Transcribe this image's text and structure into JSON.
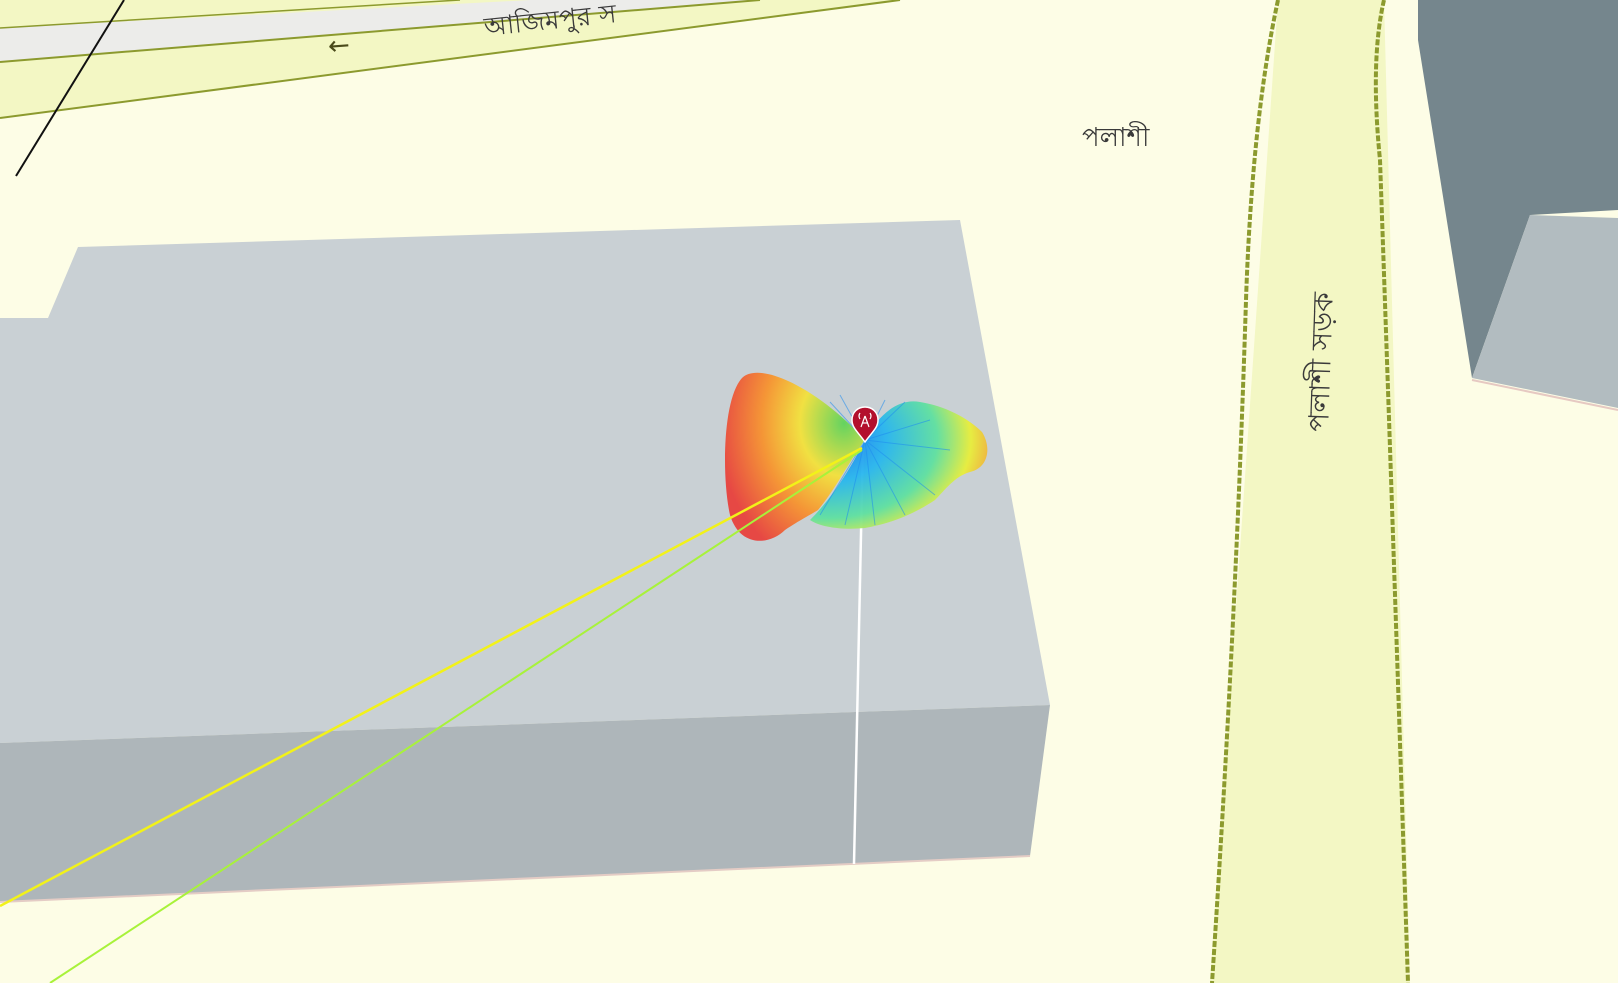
{
  "map": {
    "labels": {
      "road_top": "আজিমপুর স",
      "locality": "পলাশী",
      "road_right": "পলাশী সড়ক"
    },
    "one_way_arrow": "←",
    "colors": {
      "land": "#fdfde6",
      "road_fill": "#f3f7c4",
      "road_edge": "#8c9a2e",
      "building_top": "#c9d0d4",
      "building_front": "#aeb6ba",
      "building_side": "#75868d",
      "ray_yellow": "#f2f219",
      "ray_green": "#a8f23a",
      "marker": "#b3102d"
    },
    "icons": {
      "antenna_marker": "antenna-pin-icon"
    }
  }
}
